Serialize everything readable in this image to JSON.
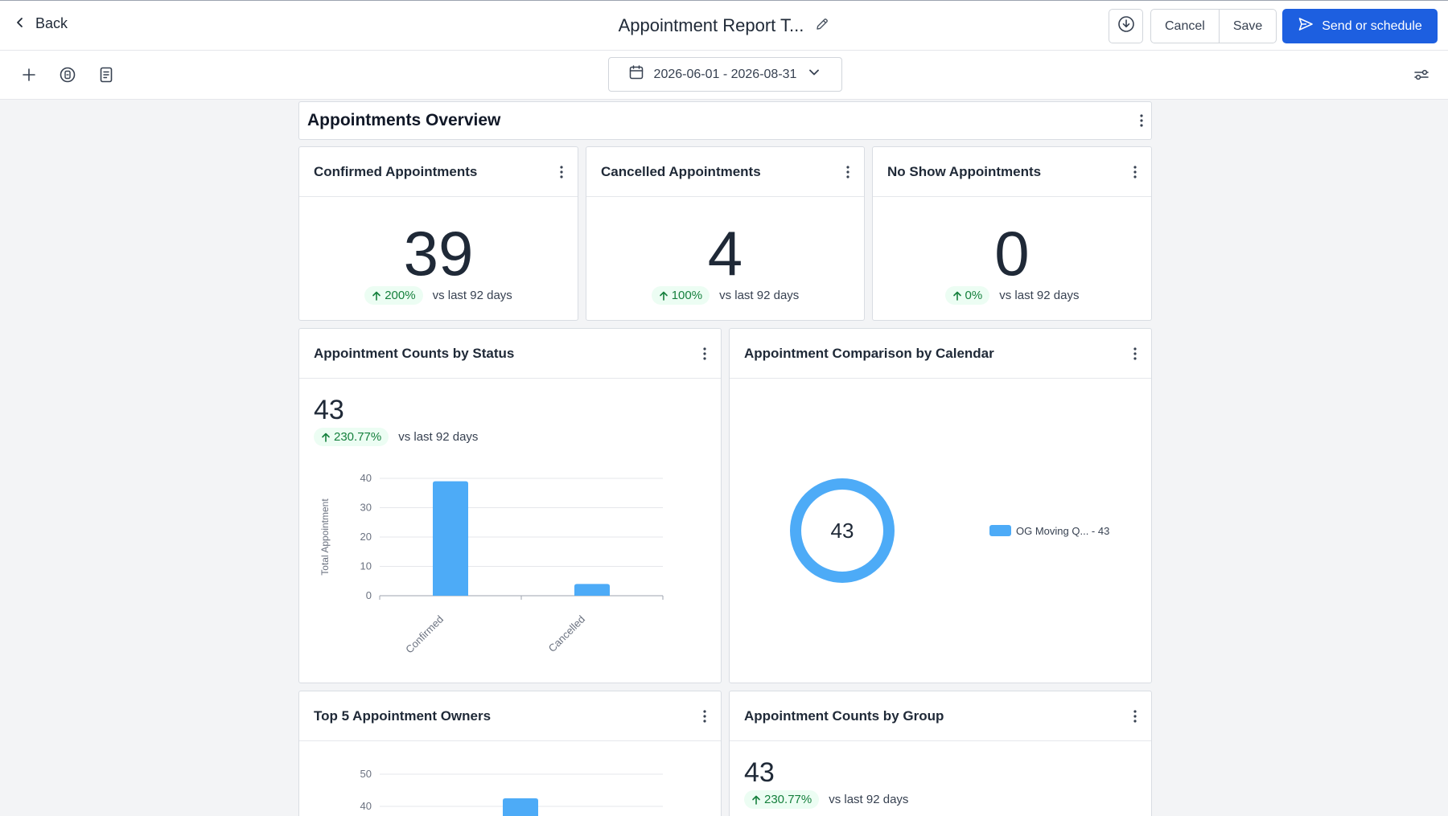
{
  "header": {
    "back_label": "Back",
    "title": "Appointment Report T...",
    "cancel_label": "Cancel",
    "save_label": "Save",
    "send_label": "Send or schedule"
  },
  "toolbar": {
    "date_range": "2026-06-01 - 2026-08-31"
  },
  "section": {
    "title": "Appointments Overview"
  },
  "kpis": [
    {
      "title": "Confirmed Appointments",
      "value": "39",
      "delta": "200%",
      "compare": "vs last 92 days"
    },
    {
      "title": "Cancelled Appointments",
      "value": "4",
      "delta": "100%",
      "compare": "vs last 92 days"
    },
    {
      "title": "No Show Appointments",
      "value": "0",
      "delta": "0%",
      "compare": "vs last 92 days"
    }
  ],
  "status_card": {
    "title": "Appointment Counts by Status",
    "total": "43",
    "delta": "230.77%",
    "compare": "vs last 92 days"
  },
  "calendar_card": {
    "title": "Appointment Comparison by Calendar",
    "donut_total": "43",
    "legend": "OG Moving Q... - 43"
  },
  "owners_card": {
    "title": "Top 5 Appointment Owners"
  },
  "group_card": {
    "title": "Appointment Counts by Group",
    "total": "43",
    "delta": "230.77%",
    "compare": "vs last 92 days"
  },
  "colors": {
    "accent": "#1d5fe0",
    "bar": "#4dabf7",
    "positive": "#15803d",
    "positive_bg": "#ecfdf3"
  },
  "chart_data": [
    {
      "type": "bar",
      "categories": [
        "Confirmed",
        "Cancelled"
      ],
      "values": [
        39,
        4
      ],
      "ylabel": "Total Appointment",
      "xlabel": "",
      "yticks": [
        0,
        10,
        20,
        30,
        40
      ],
      "ylim": [
        0,
        40
      ],
      "grid": true
    },
    {
      "type": "pie",
      "labels": [
        "OG Moving Q..."
      ],
      "values": [
        43
      ],
      "center_label": "43",
      "legend": "right"
    },
    {
      "type": "bar",
      "yticks": [
        40,
        50
      ],
      "grid": true
    }
  ]
}
